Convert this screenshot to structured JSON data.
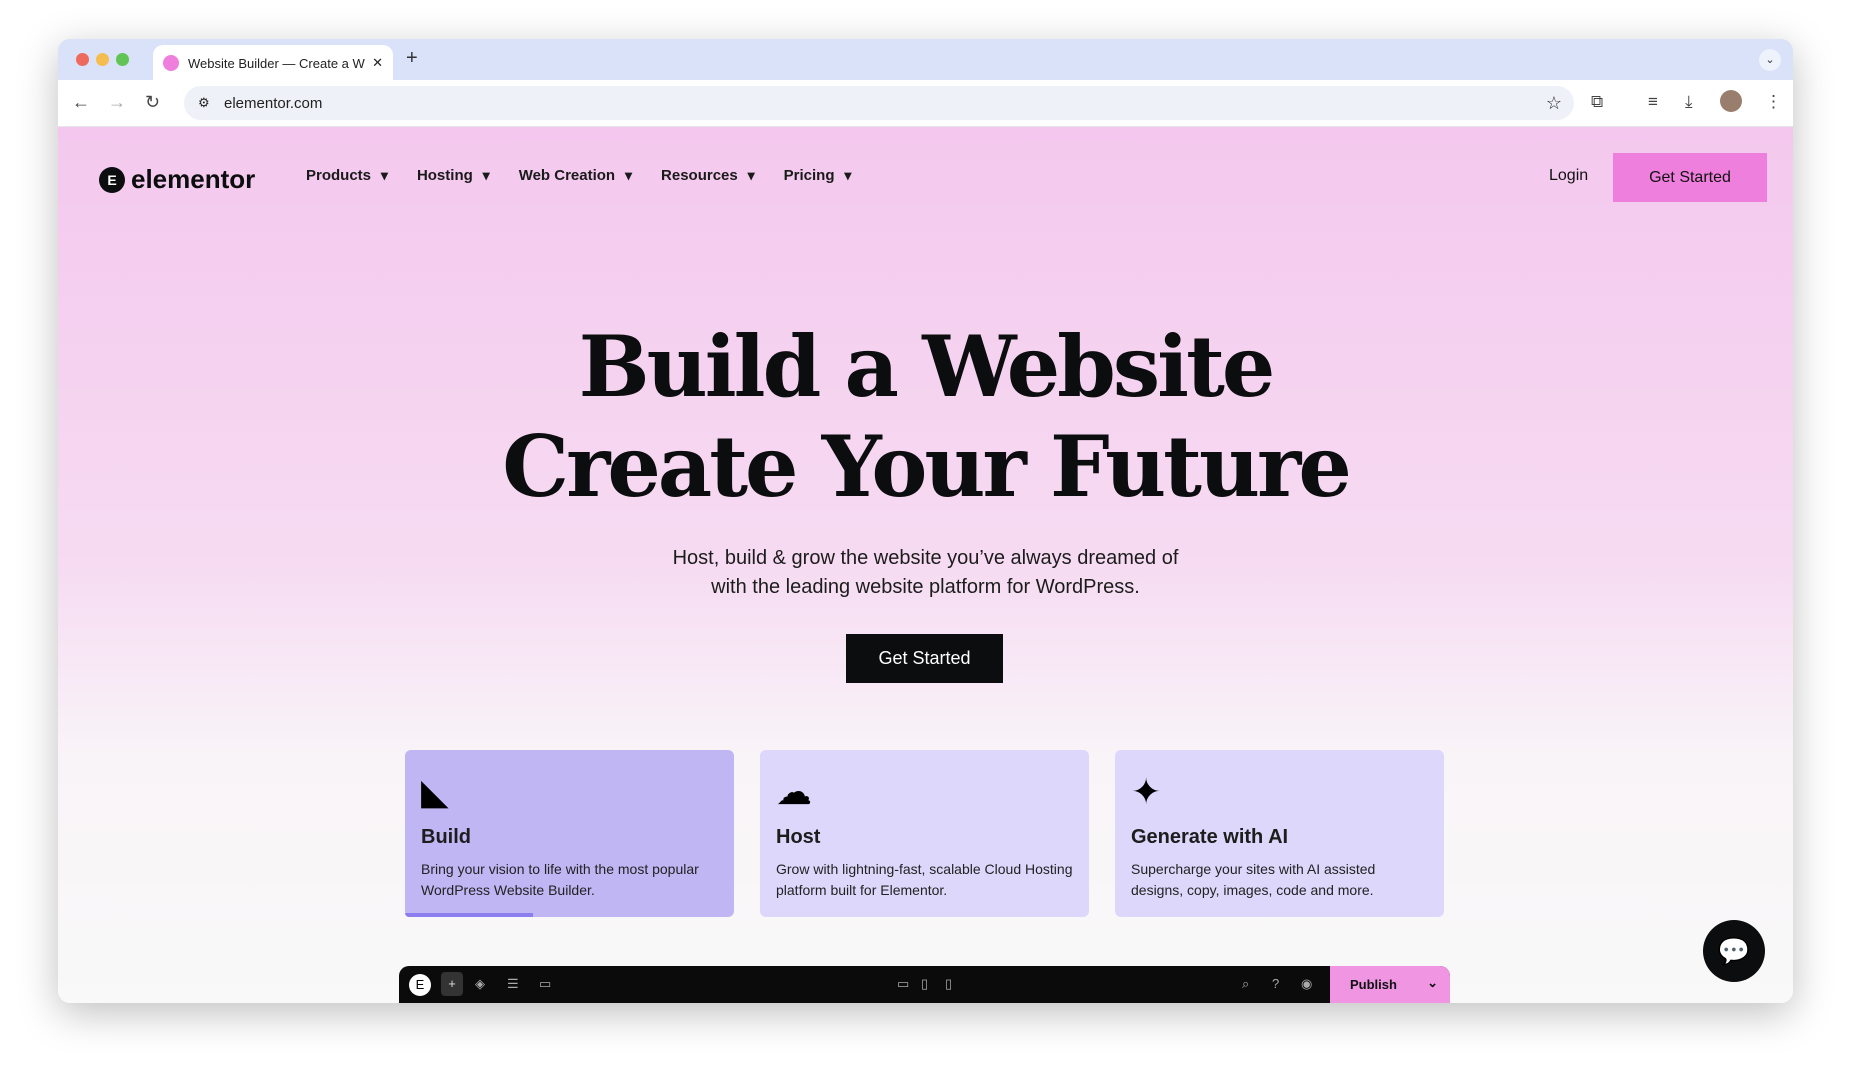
{
  "browser": {
    "tab_title": "Website Builder — Create a W",
    "url": "elementor.com"
  },
  "nav": {
    "logo": "elementor",
    "items": [
      "Products",
      "Hosting",
      "Web Creation",
      "Resources",
      "Pricing"
    ],
    "login": "Login",
    "get_started": "Get Started"
  },
  "hero": {
    "line1": "Build a Website",
    "line2": "Create Your Future",
    "sub1": "Host, build & grow the website you’ve always dreamed of",
    "sub2": "with the leading website platform for WordPress.",
    "cta": "Get Started"
  },
  "cards": [
    {
      "title": "Build",
      "desc": "Bring your vision to life with the most popular WordPress Website Builder.",
      "icon": "cursor-icon"
    },
    {
      "title": "Host",
      "desc": "Grow with lightning-fast, scalable Cloud Hosting platform built for Elementor.",
      "icon": "cloud-bolt-icon"
    },
    {
      "title": "Generate with AI",
      "desc": "Supercharge your sites with AI assisted designs, copy, images, code and more.",
      "icon": "ai-sparkle-icon"
    }
  ],
  "editor": {
    "publish": "Publish"
  },
  "colors": {
    "accent": "#ef7fdc",
    "card_active": "#c0b6f3",
    "card": "#ddd7fb"
  }
}
